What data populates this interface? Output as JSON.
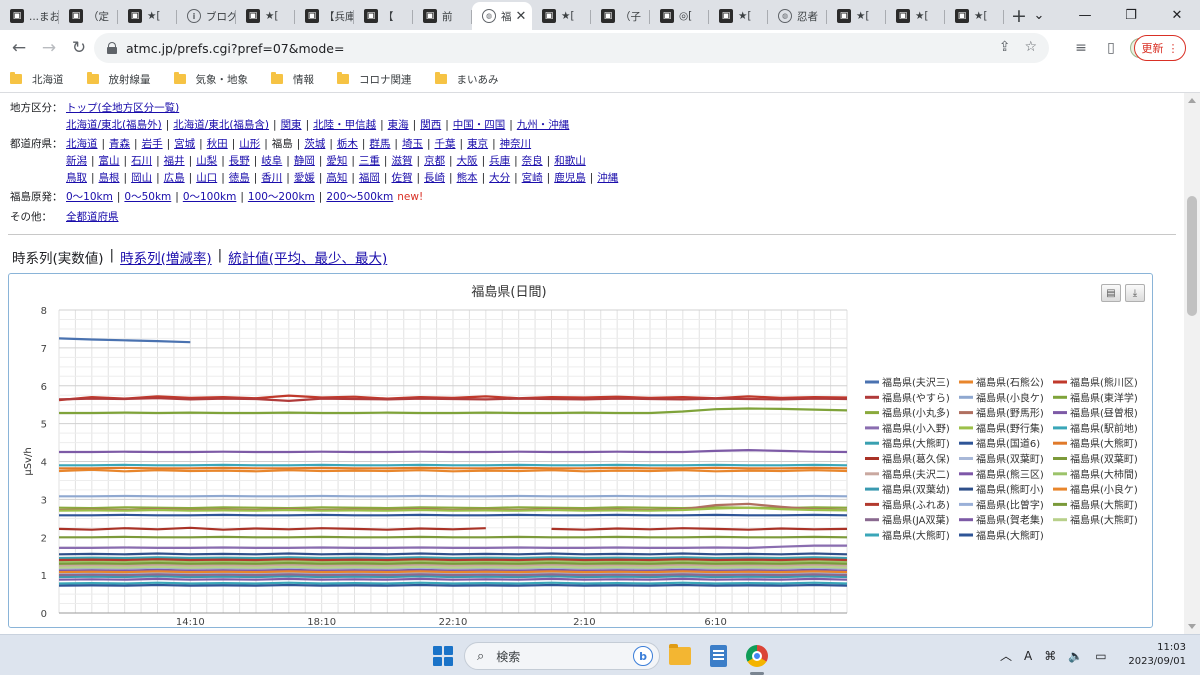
{
  "browser": {
    "tabs": [
      {
        "title": "...まお",
        "favicon": "photo-site-icon",
        "active": false
      },
      {
        "title": "（定",
        "favicon": "photo-site-icon",
        "active": false
      },
      {
        "title": "★[",
        "favicon": "photo-site-icon",
        "active": false
      },
      {
        "title": "ブログ",
        "favicon": "info-icon",
        "active": false
      },
      {
        "title": "★[",
        "favicon": "photo-site-icon",
        "active": false
      },
      {
        "title": "【兵庫",
        "favicon": "photo-site-icon",
        "active": false
      },
      {
        "title": "【",
        "favicon": "photo-site-icon",
        "active": false
      },
      {
        "title": "前",
        "favicon": "photo-site-icon",
        "active": false
      },
      {
        "title": "福",
        "favicon": "globe-icon",
        "active": true
      },
      {
        "title": "★[",
        "favicon": "photo-site-icon",
        "active": false
      },
      {
        "title": "（子",
        "favicon": "photo-site-icon",
        "active": false
      },
      {
        "title": "◎[",
        "favicon": "photo-site-icon",
        "active": false
      },
      {
        "title": "★[",
        "favicon": "photo-site-icon",
        "active": false
      },
      {
        "title": "忍者",
        "favicon": "globe-icon",
        "active": false
      },
      {
        "title": "★[",
        "favicon": "photo-site-icon",
        "active": false
      },
      {
        "title": "★[",
        "favicon": "photo-site-icon",
        "active": false
      },
      {
        "title": "★[",
        "favicon": "photo-site-icon",
        "active": false
      }
    ],
    "url": "atmc.jp/prefs.cgi?pref=07&mode=",
    "update_label": "更新",
    "bookmarks": [
      "北海道",
      "放射線量",
      "気象・地象",
      "情報",
      "コロナ関連",
      "まいあみ"
    ]
  },
  "nav": {
    "region": {
      "label": "地方区分：",
      "top_link": "トップ(全地方区分一覧)",
      "links": [
        "北海道/東北(福島外)",
        "北海道/東北(福島含)",
        "関東",
        "北陸・甲信越",
        "東海",
        "関西",
        "中国・四国",
        "九州・沖縄"
      ]
    },
    "prefecture": {
      "label": "都道府県：",
      "current": "福島",
      "row1": [
        "北海道",
        "青森",
        "岩手",
        "宮城",
        "秋田",
        "山形",
        "福島",
        "茨城",
        "栃木",
        "群馬",
        "埼玉",
        "千葉",
        "東京",
        "神奈川"
      ],
      "row2": [
        "新潟",
        "富山",
        "石川",
        "福井",
        "山梨",
        "長野",
        "岐阜",
        "静岡",
        "愛知",
        "三重",
        "滋賀",
        "京都",
        "大阪",
        "兵庫",
        "奈良",
        "和歌山"
      ],
      "row3": [
        "鳥取",
        "島根",
        "岡山",
        "広島",
        "山口",
        "徳島",
        "香川",
        "愛媛",
        "高知",
        "福岡",
        "佐賀",
        "長崎",
        "熊本",
        "大分",
        "宮崎",
        "鹿児島",
        "沖縄"
      ]
    },
    "nuclear": {
      "label": "福島原発：",
      "links": [
        "0〜10km",
        "0〜50km",
        "0〜100km",
        "100〜200km",
        "200〜500km"
      ],
      "new_label": "new!"
    },
    "other": {
      "label": "その他：",
      "links": [
        "全都道府県"
      ]
    }
  },
  "view_tabs": {
    "current": "時系列(実数値)",
    "links": [
      "時系列(増減率)",
      "統計値(平均、最少、最大)"
    ]
  },
  "chart_data": {
    "type": "line",
    "title": "福島県(日間)",
    "ylabel": "µSv/h",
    "xlabel": "",
    "ylim": [
      0,
      8
    ],
    "yticks": [
      0,
      1,
      2,
      3,
      4,
      5,
      6,
      7,
      8
    ],
    "xticks": [
      "14:10",
      "18:10",
      "22:10",
      "2:10",
      "6:10"
    ],
    "xtick_positions": [
      4,
      8,
      12,
      16,
      20
    ],
    "x_range": [
      0,
      24
    ],
    "grid": true,
    "legend_position": "right",
    "series": [
      {
        "name": "福島県(夫沢三)",
        "color": "#4a72b0",
        "values": [
          7.25,
          7.22,
          7.2,
          7.18,
          7.15,
          null,
          null,
          null,
          null,
          null,
          null,
          null,
          null,
          null,
          null,
          null,
          null,
          null,
          null,
          null,
          null,
          null,
          null,
          null,
          null
        ]
      },
      {
        "name": "福島県(石熊公)",
        "color": "#e8862c",
        "values": [
          3.75,
          3.78,
          3.74,
          3.77,
          3.75,
          3.76,
          3.74,
          3.77,
          3.75,
          3.76,
          3.75,
          3.77,
          3.74,
          3.76,
          3.75,
          3.77,
          3.74,
          3.76,
          3.75,
          3.77,
          3.74,
          3.76,
          3.75,
          3.77,
          3.75
        ]
      },
      {
        "name": "福島県(熊川区)",
        "color": "#c0392b",
        "values": [
          5.62,
          5.7,
          5.66,
          5.72,
          5.68,
          5.7,
          5.67,
          5.74,
          5.69,
          5.71,
          5.66,
          5.7,
          5.68,
          5.72,
          5.67,
          5.7,
          5.69,
          5.71,
          5.68,
          5.7,
          5.67,
          5.72,
          5.68,
          5.7,
          5.69
        ]
      },
      {
        "name": "福島県(やすら)",
        "color": "#b03a3a",
        "values": [
          5.64,
          5.66,
          5.65,
          5.67,
          5.64,
          5.66,
          5.65,
          5.6,
          5.66,
          5.65,
          5.64,
          5.66,
          5.65,
          5.64,
          5.66,
          5.65,
          5.64,
          5.66,
          5.65,
          5.64,
          5.66,
          5.65,
          5.64,
          5.66,
          5.65
        ]
      },
      {
        "name": "福島県(小良ケ)",
        "color": "#8fa8d0",
        "values": [
          3.08,
          3.08,
          3.09,
          3.08,
          3.08,
          3.09,
          3.08,
          3.08,
          3.09,
          3.08,
          3.08,
          3.09,
          3.08,
          3.08,
          3.09,
          3.08,
          3.08,
          3.09,
          3.08,
          3.08,
          3.09,
          3.08,
          3.08,
          3.09,
          3.08
        ]
      },
      {
        "name": "福島県(東洋学)",
        "color": "#7fa33a",
        "values": [
          5.28,
          5.28,
          5.29,
          5.28,
          5.29,
          5.28,
          5.28,
          5.29,
          5.28,
          5.28,
          5.29,
          5.28,
          5.28,
          5.29,
          5.28,
          5.28,
          5.29,
          5.28,
          5.28,
          5.32,
          5.38,
          5.4,
          5.39,
          5.37,
          5.35
        ]
      },
      {
        "name": "福島県(小丸多)",
        "color": "#8aaa3c",
        "values": [
          2.78,
          2.77,
          2.79,
          2.78,
          2.77,
          2.79,
          2.78,
          2.77,
          2.79,
          2.78,
          2.77,
          2.79,
          2.78,
          2.77,
          2.79,
          2.78,
          2.77,
          2.79,
          2.78,
          2.77,
          2.79,
          2.78,
          2.77,
          2.79,
          2.78
        ]
      },
      {
        "name": "福島県(野馬形)",
        "color": "#b07060",
        "values": [
          2.72,
          2.73,
          2.72,
          2.74,
          2.72,
          2.73,
          2.72,
          2.74,
          2.72,
          2.73,
          2.72,
          2.74,
          2.72,
          2.73,
          2.72,
          2.74,
          2.72,
          2.73,
          2.72,
          2.74,
          2.85,
          2.88,
          2.8,
          2.74,
          2.72
        ]
      },
      {
        "name": "福島県(昼曽根)",
        "color": "#7d5aa6",
        "values": [
          4.25,
          4.25,
          4.26,
          4.25,
          4.25,
          4.26,
          4.25,
          4.25,
          4.26,
          4.25,
          4.25,
          4.26,
          4.25,
          4.25,
          4.26,
          4.25,
          4.25,
          4.26,
          4.25,
          4.25,
          4.28,
          4.3,
          4.28,
          4.26,
          4.25
        ]
      },
      {
        "name": "福島県(小入野)",
        "color": "#8a6db0",
        "values": [
          1.72,
          1.72,
          1.73,
          1.72,
          1.72,
          1.73,
          1.72,
          1.72,
          1.73,
          1.72,
          1.72,
          1.73,
          1.72,
          1.72,
          1.73,
          1.72,
          1.72,
          1.73,
          1.72,
          1.72,
          1.73,
          1.72,
          1.75,
          1.78,
          1.78
        ]
      },
      {
        "name": "福島県(野行集)",
        "color": "#9cc04a",
        "values": [
          2.7,
          2.71,
          2.7,
          2.72,
          2.7,
          2.71,
          2.7,
          2.72,
          2.7,
          2.71,
          2.7,
          2.72,
          2.7,
          2.71,
          2.7,
          2.72,
          2.7,
          2.71,
          2.7,
          2.72,
          2.76,
          2.78,
          2.74,
          2.72,
          2.71
        ]
      },
      {
        "name": "福島県(駅前地)",
        "color": "#3aa6b8",
        "values": [
          3.9,
          3.9,
          3.91,
          3.9,
          3.9,
          3.91,
          3.9,
          3.9,
          3.91,
          3.9,
          3.9,
          3.91,
          3.9,
          3.9,
          3.91,
          3.9,
          3.9,
          3.91,
          3.9,
          3.9,
          3.91,
          3.9,
          3.9,
          3.91,
          3.9
        ]
      },
      {
        "name": "福島県(大熊町)",
        "color": "#39a0b0",
        "values": [
          1.45,
          1.46,
          1.45,
          1.47,
          1.45,
          1.46,
          1.45,
          1.47,
          1.45,
          1.46,
          1.45,
          1.47,
          1.45,
          1.46,
          1.45,
          1.47,
          1.45,
          1.46,
          1.45,
          1.47,
          1.45,
          1.46,
          1.45,
          1.47,
          1.45
        ]
      },
      {
        "name": "福島県(国道6)",
        "color": "#2f5597",
        "values": [
          2.58,
          2.58,
          2.59,
          2.58,
          2.58,
          2.59,
          2.58,
          2.58,
          2.59,
          2.58,
          2.58,
          2.59,
          2.58,
          2.58,
          2.59,
          2.58,
          2.58,
          2.59,
          2.58,
          2.58,
          2.59,
          2.58,
          2.58,
          2.59,
          2.58
        ]
      },
      {
        "name": "福島県(大熊町)",
        "color": "#e07a2a",
        "values": [
          3.82,
          3.82,
          3.83,
          3.82,
          3.82,
          3.83,
          3.82,
          3.82,
          3.83,
          3.82,
          3.82,
          3.83,
          3.82,
          3.82,
          3.83,
          3.82,
          3.82,
          3.83,
          3.82,
          3.82,
          3.83,
          3.82,
          3.82,
          3.83,
          3.82
        ]
      },
      {
        "name": "福島県(葛久保)",
        "color": "#a93226",
        "values": [
          2.22,
          2.2,
          2.24,
          2.21,
          2.25,
          2.2,
          2.23,
          2.21,
          2.24,
          2.22,
          2.2,
          2.23,
          2.21,
          2.24,
          null,
          2.22,
          2.2,
          2.23,
          2.21,
          2.24,
          2.22,
          2.2,
          2.23,
          2.21,
          2.22
        ]
      },
      {
        "name": "福島県(双葉町)",
        "color": "#a8b8d8",
        "values": [
          1.05,
          1.06,
          1.05,
          1.07,
          1.05,
          1.06,
          1.05,
          1.07,
          1.05,
          1.06,
          1.05,
          1.07,
          1.05,
          1.06,
          1.05,
          1.07,
          1.05,
          1.06,
          1.05,
          1.07,
          1.05,
          1.06,
          1.05,
          1.07,
          1.05
        ]
      },
      {
        "name": "福島県(双葉町)",
        "color": "#7c9a3a",
        "values": [
          2.0,
          2.0,
          2.01,
          2.0,
          2.0,
          2.01,
          2.0,
          2.0,
          2.01,
          2.0,
          2.0,
          2.01,
          2.0,
          2.0,
          2.01,
          2.0,
          2.0,
          2.01,
          2.0,
          2.0,
          2.01,
          2.0,
          2.0,
          2.01,
          2.0
        ]
      },
      {
        "name": "福島県(夫沢二)",
        "color": "#c9a8a0",
        "values": [
          1.25,
          1.26,
          1.25,
          1.27,
          1.25,
          1.26,
          1.25,
          1.27,
          1.25,
          1.26,
          1.25,
          1.27,
          1.25,
          1.26,
          1.25,
          1.27,
          1.25,
          1.26,
          1.25,
          1.27,
          1.25,
          1.26,
          1.25,
          1.27,
          1.25
        ]
      },
      {
        "name": "福島県(熊三区)",
        "color": "#7e57a8",
        "values": [
          1.12,
          1.13,
          1.12,
          1.14,
          1.12,
          1.13,
          1.12,
          1.14,
          1.12,
          1.13,
          1.12,
          1.14,
          1.12,
          1.13,
          1.12,
          1.14,
          1.12,
          1.13,
          1.12,
          1.14,
          1.12,
          1.13,
          1.12,
          1.14,
          1.12
        ]
      },
      {
        "name": "福島県(大柿間)",
        "color": "#9cc36a",
        "values": [
          1.35,
          1.36,
          1.35,
          1.37,
          1.35,
          1.36,
          1.35,
          1.37,
          1.35,
          1.36,
          1.35,
          1.37,
          1.35,
          1.36,
          1.35,
          1.37,
          1.35,
          1.36,
          1.35,
          1.37,
          1.35,
          1.36,
          1.35,
          1.37,
          1.35
        ]
      },
      {
        "name": "福島県(双葉幼)",
        "color": "#3a9ab0",
        "values": [
          0.95,
          0.96,
          0.95,
          0.97,
          0.95,
          0.96,
          0.95,
          0.97,
          0.95,
          0.96,
          0.95,
          0.97,
          0.95,
          0.96,
          0.95,
          0.97,
          0.95,
          0.96,
          0.95,
          0.97,
          0.95,
          0.96,
          0.95,
          0.97,
          0.95
        ]
      },
      {
        "name": "福島県(熊町小)",
        "color": "#2e4f8a",
        "values": [
          1.55,
          1.56,
          1.55,
          1.57,
          1.55,
          1.56,
          1.55,
          1.57,
          1.55,
          1.56,
          1.55,
          1.57,
          1.55,
          1.56,
          1.55,
          1.57,
          1.55,
          1.56,
          1.55,
          1.57,
          1.55,
          1.56,
          1.55,
          1.57,
          1.55
        ]
      },
      {
        "name": "福島県(小良ケ)",
        "color": "#e8862c",
        "values": [
          1.08,
          1.09,
          1.08,
          1.1,
          1.08,
          1.09,
          1.08,
          1.1,
          1.08,
          1.09,
          1.08,
          1.1,
          1.08,
          1.09,
          1.08,
          1.1,
          1.08,
          1.09,
          1.08,
          1.1,
          1.08,
          1.09,
          1.08,
          1.1,
          1.08
        ]
      },
      {
        "name": "福島県(ふれあ)",
        "color": "#b23a2e",
        "values": [
          1.4,
          1.41,
          1.4,
          1.42,
          1.4,
          1.41,
          1.4,
          1.42,
          1.4,
          1.41,
          1.4,
          1.42,
          1.4,
          1.41,
          1.4,
          1.42,
          1.4,
          1.41,
          1.4,
          1.42,
          1.4,
          1.41,
          1.4,
          1.42,
          1.4
        ]
      },
      {
        "name": "福島県(比曽字)",
        "color": "#9ab0d8",
        "values": [
          1.18,
          1.19,
          1.18,
          1.2,
          1.18,
          1.19,
          1.18,
          1.2,
          1.18,
          1.19,
          1.18,
          1.2,
          1.18,
          1.19,
          1.18,
          1.2,
          1.18,
          1.19,
          1.18,
          1.2,
          1.18,
          1.19,
          1.18,
          1.2,
          1.18
        ]
      },
      {
        "name": "福島県(大熊町)",
        "color": "#7a9a3a",
        "values": [
          1.3,
          1.31,
          1.3,
          1.32,
          1.3,
          1.31,
          1.3,
          1.32,
          1.3,
          1.31,
          1.3,
          1.32,
          1.3,
          1.31,
          1.3,
          1.32,
          1.3,
          1.31,
          1.3,
          1.32,
          1.3,
          1.31,
          1.3,
          1.32,
          1.3
        ]
      },
      {
        "name": "福島県(JA双葉)",
        "color": "#8a6a90",
        "values": [
          1.0,
          1.01,
          1.0,
          1.02,
          1.0,
          1.01,
          1.0,
          1.02,
          1.0,
          1.01,
          1.0,
          1.02,
          1.0,
          1.01,
          1.0,
          1.02,
          1.0,
          1.01,
          1.0,
          1.02,
          1.0,
          1.01,
          1.0,
          1.02,
          1.0
        ]
      },
      {
        "name": "福島県(賀老集)",
        "color": "#7d5aa6",
        "values": [
          0.88,
          0.89,
          0.88,
          0.9,
          0.88,
          0.89,
          0.88,
          0.9,
          0.88,
          0.89,
          0.88,
          0.9,
          0.88,
          0.89,
          0.88,
          0.9,
          0.88,
          0.89,
          0.88,
          0.9,
          0.88,
          0.89,
          0.88,
          0.9,
          0.88
        ]
      },
      {
        "name": "福島県(大熊町)",
        "color": "#b8d08a",
        "values": [
          1.2,
          1.21,
          1.2,
          1.22,
          1.2,
          1.21,
          1.2,
          1.22,
          1.2,
          1.21,
          1.2,
          1.22,
          1.2,
          1.21,
          1.2,
          1.22,
          1.2,
          1.21,
          1.2,
          1.22,
          1.2,
          1.21,
          1.2,
          1.22,
          1.2
        ]
      },
      {
        "name": "福島県(大熊町)",
        "color": "#3aa6b8",
        "values": [
          0.78,
          0.79,
          0.78,
          0.8,
          0.78,
          0.79,
          0.78,
          0.8,
          0.78,
          0.79,
          0.78,
          0.8,
          0.78,
          0.79,
          0.78,
          0.8,
          0.78,
          0.79,
          0.78,
          0.8,
          0.78,
          0.79,
          0.78,
          0.8,
          0.78
        ]
      },
      {
        "name": "福島県(大熊町)",
        "color": "#2f5597",
        "values": [
          0.72,
          0.73,
          0.72,
          0.74,
          0.72,
          0.73,
          0.72,
          0.74,
          0.72,
          0.73,
          0.72,
          0.74,
          0.72,
          0.73,
          0.72,
          0.74,
          0.72,
          0.73,
          0.72,
          0.74,
          0.72,
          0.73,
          0.72,
          0.74,
          0.72
        ]
      }
    ]
  },
  "taskbar": {
    "search_placeholder": "検索",
    "ime": "A",
    "time": "11:03",
    "date": "2023/09/01"
  }
}
